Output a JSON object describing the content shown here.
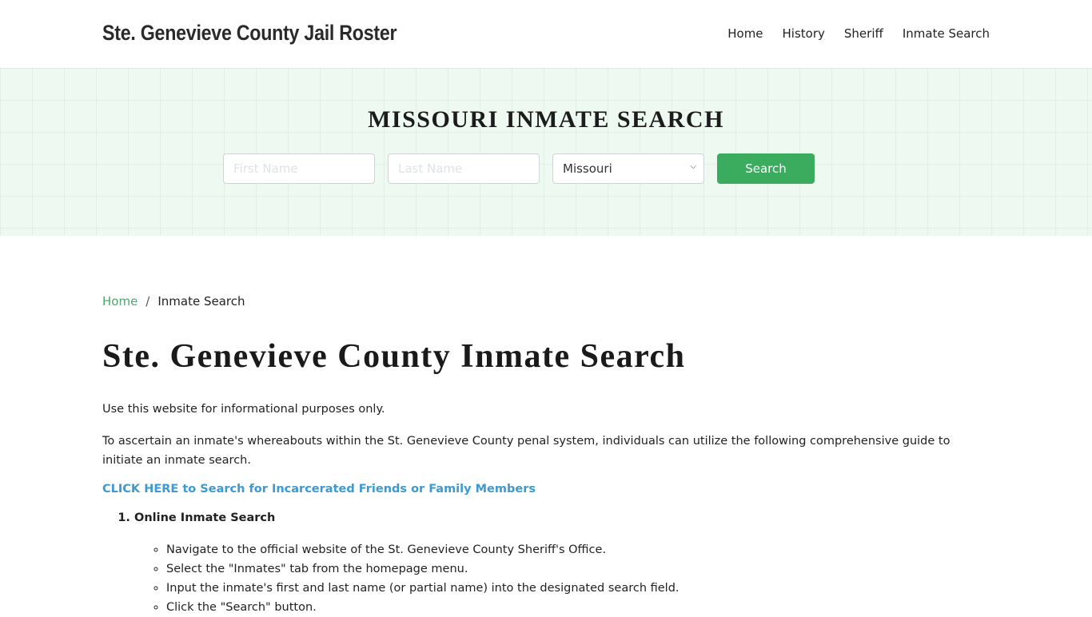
{
  "header": {
    "brand": "Ste. Genevieve County Jail Roster",
    "nav": [
      {
        "label": "Home"
      },
      {
        "label": "History"
      },
      {
        "label": "Sheriff"
      },
      {
        "label": "Inmate Search"
      }
    ]
  },
  "hero": {
    "title": "MISSOURI INMATE SEARCH",
    "first_name_placeholder": "First Name",
    "last_name_placeholder": "Last Name",
    "state_selected": "Missouri",
    "search_label": "Search"
  },
  "breadcrumb": {
    "home": "Home",
    "separator": "/",
    "current": "Inmate Search"
  },
  "main": {
    "title": "Ste. Genevieve County Inmate Search",
    "intro": "Use this website for informational purposes only.",
    "paragraph": "To ascertain an inmate's whereabouts within the St. Genevieve County penal system, individuals can utilize the following comprehensive guide to initiate an inmate search.",
    "cta": "CLICK HERE to Search for Incarcerated Friends or Family Members",
    "steps": [
      {
        "title": "Online Inmate Search",
        "items": [
          "Navigate to the official website of the St. Genevieve County Sheriff's Office.",
          "Select the \"Inmates\" tab from the homepage menu.",
          "Input the inmate's first and last name (or partial name) into the designated search field.",
          "Click the \"Search\" button."
        ]
      }
    ]
  },
  "colors": {
    "accent_green": "#3bab5e",
    "link_blue": "#3d9ad1",
    "hero_bg": "#eef9f2"
  }
}
